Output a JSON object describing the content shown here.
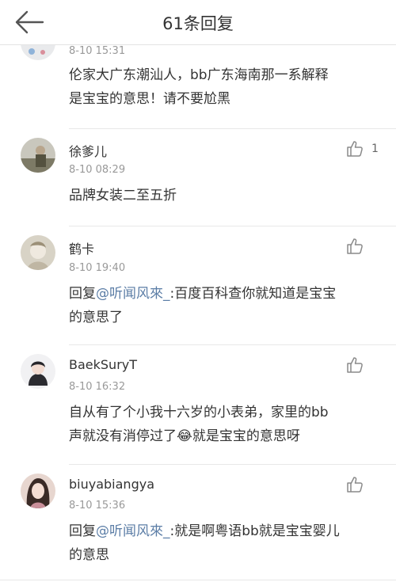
{
  "header": {
    "title": "61条回复",
    "back_icon": "arrow-left-icon"
  },
  "comments": [
    {
      "time": "8-10 15:31",
      "text_lines": [
        "伦家大广东潮汕人，bb广东海南那一系解释",
        "是宝宝的意思！请不要尬黑"
      ]
    },
    {
      "name": "徐爹儿",
      "time": "8-10 08:29",
      "like_count": "1",
      "text_lines": [
        "品牌女装二至五折"
      ]
    },
    {
      "name": "鹤卡",
      "time": "8-10 19:40",
      "reply_prefix": "回复",
      "mention": "@听闻风來_",
      "text_lines": [
        ":百度百科查你就知道是宝宝",
        "的意思了"
      ]
    },
    {
      "name": "BaekSuryT",
      "time": "8-10 16:32",
      "text_lines": [
        "自从有了个小我十六岁的小表弟，家里的bb",
        "声就没有消停过了",
        "😂",
        "就是宝宝的意思呀"
      ]
    },
    {
      "name": "biuyabiangya",
      "time": "8-10 15:36",
      "reply_prefix": "回复",
      "mention": "@听闻风來_",
      "text_lines": [
        ":就是啊粤语bb就是宝宝婴儿",
        "的意思"
      ]
    }
  ],
  "colors": {
    "mention": "#5b7da6",
    "time": "#999999",
    "text": "#333333"
  },
  "icons": [
    "arrow-left-icon",
    "thumbs-up-icon"
  ]
}
